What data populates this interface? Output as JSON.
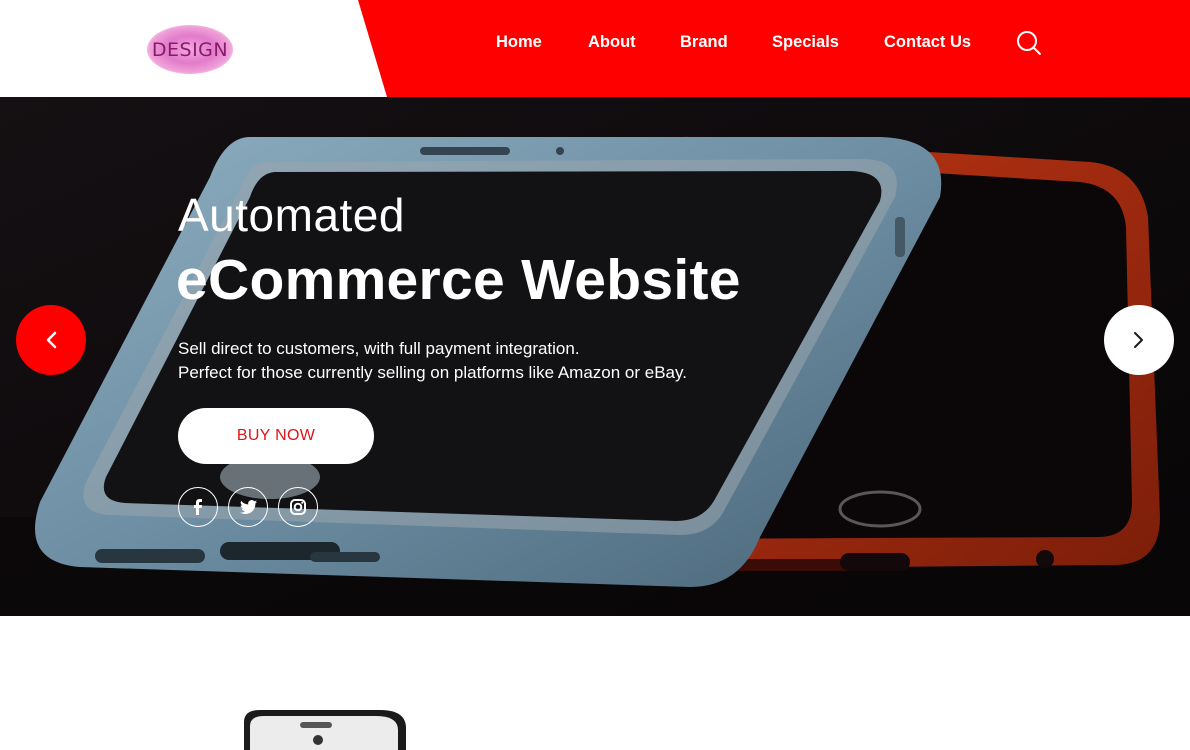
{
  "brand": {
    "logo_text": "DESIGN",
    "logo_color": "#e27ccb"
  },
  "nav": {
    "items": [
      {
        "label": "Home"
      },
      {
        "label": "About"
      },
      {
        "label": "Brand"
      },
      {
        "label": "Specials"
      },
      {
        "label": "Contact Us"
      }
    ],
    "search_icon": "search-icon"
  },
  "hero": {
    "title_line1": "Automated",
    "title_line2": "eCommerce Website",
    "desc_line1": "Sell direct to customers, with full payment integration.",
    "desc_line2": "Perfect for those currently selling on platforms like Amazon or eBay.",
    "cta_label": "BUY NOW",
    "social": [
      "facebook-icon",
      "twitter-icon",
      "instagram-icon"
    ],
    "prev_icon": "chevron-left-icon",
    "next_icon": "chevron-right-icon"
  },
  "colors": {
    "accent": "#fe0000",
    "cta_text": "#e0141a",
    "hero_bg": "#0c0709",
    "white": "#ffffff"
  }
}
